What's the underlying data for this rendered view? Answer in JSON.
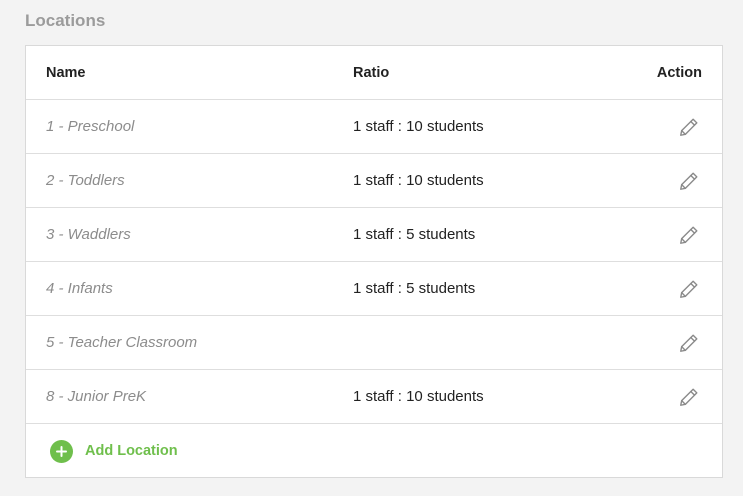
{
  "section": {
    "title": "Locations"
  },
  "table": {
    "headers": {
      "name": "Name",
      "ratio": "Ratio",
      "action": "Action"
    },
    "rows": [
      {
        "name": "1 - Preschool",
        "ratio": "1 staff : 10 students",
        "action_icon": "pencil-icon"
      },
      {
        "name": "2 - Toddlers",
        "ratio": "1 staff : 10 students",
        "action_icon": "pencil-icon"
      },
      {
        "name": "3 - Waddlers",
        "ratio": "1 staff : 5 students",
        "action_icon": "pencil-icon"
      },
      {
        "name": "4 - Infants",
        "ratio": "1 staff : 5 students",
        "action_icon": "pencil-icon"
      },
      {
        "name": "5 - Teacher Classroom",
        "ratio": "",
        "action_icon": "pencil-icon"
      },
      {
        "name": "8 - Junior PreK",
        "ratio": "1 staff : 10 students",
        "action_icon": "pencil-icon"
      }
    ]
  },
  "add": {
    "label": "Add Location",
    "icon": "plus-circle-icon"
  },
  "colors": {
    "accent": "#6fbf4c",
    "title": "#9b9b9b",
    "name_text": "#8c8c8c",
    "icon": "#8a8a8a",
    "border": "#dedede",
    "background": "#f3f3f3"
  }
}
